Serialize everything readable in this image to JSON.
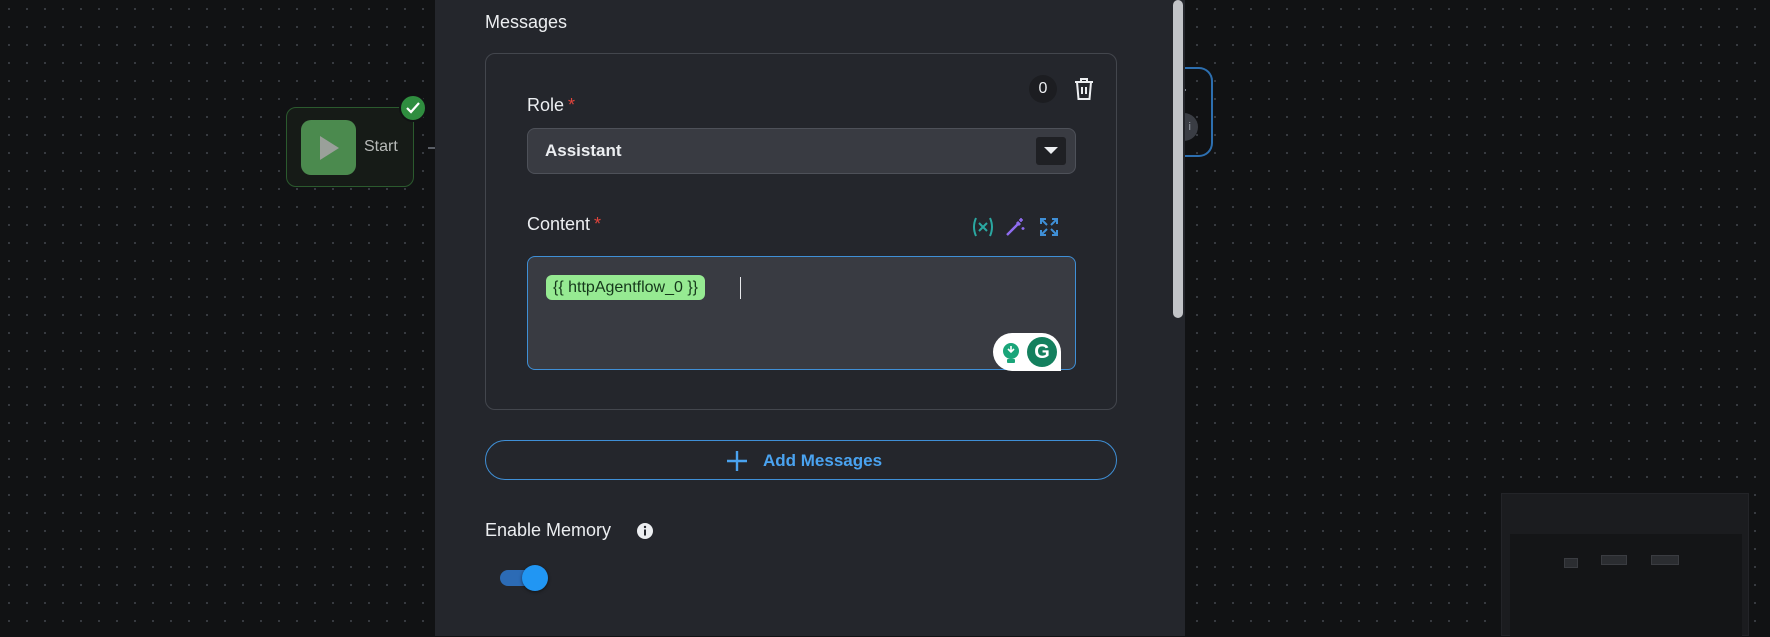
{
  "canvas": {
    "start_node_label": "Start",
    "right_node_badge": "i"
  },
  "panel": {
    "messages_label": "Messages",
    "message": {
      "count": "0",
      "role_label": "Role",
      "required_mark": "*",
      "role_value": "Assistant",
      "content_label": "Content",
      "content_value": "{{ httpAgentflow_0 }}",
      "grammarly_glyph": "G"
    },
    "add_messages_label": "Add Messages",
    "enable_memory_label": "Enable Memory",
    "enable_memory_on": true
  },
  "colors": {
    "accent": "#2196f3",
    "variable_chip": "#96ea92",
    "required": "#e0443c",
    "start_green": "#4b8a4e"
  },
  "icons": {
    "start": "play-icon",
    "status": "check-icon",
    "delete": "trash-icon",
    "dropdown": "caret-down-icon",
    "variable": "variable-icon",
    "magic": "magic-wand-icon",
    "expand": "expand-icon",
    "add": "plus-icon",
    "info": "info-icon"
  }
}
